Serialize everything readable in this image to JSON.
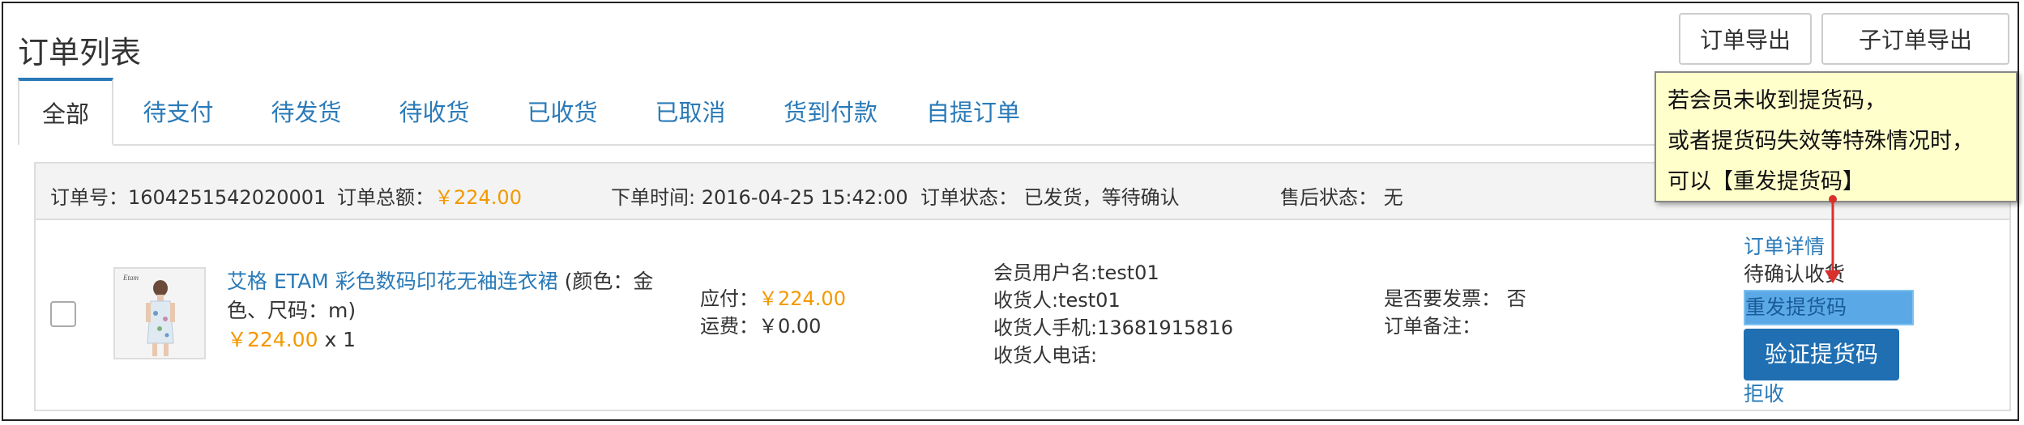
{
  "page": {
    "title": "订单列表"
  },
  "header_buttons": {
    "export_orders": "订单导出",
    "export_suborders": "子订单导出"
  },
  "tabs": [
    {
      "label": "全部",
      "active": true
    },
    {
      "label": "待支付"
    },
    {
      "label": "待发货"
    },
    {
      "label": "待收货"
    },
    {
      "label": "已收货"
    },
    {
      "label": "已取消"
    },
    {
      "label": "货到付款"
    },
    {
      "label": "自提订单"
    }
  ],
  "order": {
    "order_no_label": "订单号：",
    "order_no": "1604251542020001",
    "total_label": "订单总额：",
    "total": "￥224.00",
    "time_label": "下单时间:",
    "time": "2016-04-25 15:42:00",
    "status_label": "订单状态：",
    "status": "已发货，等待确认",
    "aftersale_label": "售后状态：",
    "aftersale": "无",
    "product": {
      "name": "艾格 ETAM 彩色数码印花无袖连衣裙",
      "attrs": "(颜色：金色、尺码：m)",
      "price": "￥224.00",
      "qty": "x 1",
      "image_label": "Etam"
    },
    "payable_label": "应付：",
    "payable": "￥224.00",
    "shipping_label": "运费：",
    "shipping": "￥0.00",
    "member_username": "会员用户名:test01",
    "receiver": "收货人:test01",
    "receiver_mobile": "收货人手机:13681915816",
    "receiver_phone": "收货人电话:",
    "invoice": "是否要发票： 否",
    "remark": "订单备注：",
    "actions": {
      "detail": "订单详情",
      "confirm": "待确认收货",
      "resend": "重发提货码",
      "verify": "验证提货码",
      "reject": "拒收"
    }
  },
  "tooltip": {
    "line1": "若会员未收到提货码，",
    "line2": "或者提货码失效等特殊情况时，",
    "line3": "可以【重发提货码】"
  },
  "colors": {
    "link": "#2a7ab8",
    "price": "#f39800",
    "verify_bg": "#1f6fb2",
    "tooltip_bg": "#ffffcc",
    "arrow": "#d9302c"
  }
}
